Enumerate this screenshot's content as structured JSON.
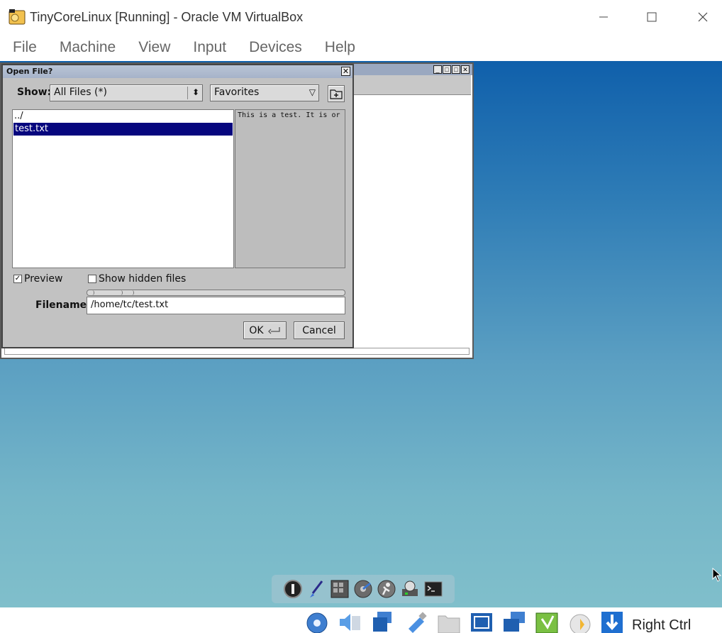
{
  "host": {
    "title": "TinyCoreLinux [Running] - Oracle VM VirtualBox",
    "menu": [
      "File",
      "Machine",
      "View",
      "Input",
      "Devices",
      "Help"
    ],
    "status_key": "Right Ctrl"
  },
  "dialog": {
    "title": "Open File?",
    "show_label": "Show:",
    "filter_value": "All Files (*)",
    "favorites_value": "Favorites",
    "files": [
      "../",
      "test.txt"
    ],
    "selected_file": "test.txt",
    "preview_text": "This is a test.  It is or",
    "preview_label": "Preview",
    "preview_checked": true,
    "show_hidden_label": "Show hidden files",
    "show_hidden_checked": false,
    "filename_label": "Filename:",
    "filename_value": "/home/tc/test.txt",
    "ok_label": "OK",
    "cancel_label": "Cancel"
  },
  "wbar_icons": [
    "exit-icon",
    "paint-brush-icon",
    "apps-grid-icon",
    "mount-tool-icon",
    "control-panel-icon",
    "network-icon",
    "terminal-icon"
  ],
  "status_icons": [
    "hard-disk-icon",
    "audio-icon",
    "network-adapters-icon",
    "usb-icon",
    "shared-folders-icon",
    "display-icon",
    "screen-capture-icon",
    "video-capture-icon",
    "cpu-load-icon",
    "mouse-integration-icon",
    "keyboard-capture-icon"
  ]
}
